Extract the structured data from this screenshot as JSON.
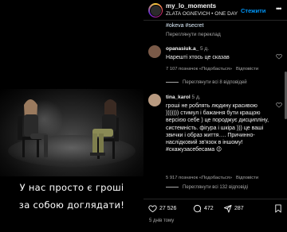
{
  "video": {
    "caption_line1": "У нас просто є гроші",
    "caption_line2": "за собою доглядати!"
  },
  "header": {
    "username": "my_lo_moments",
    "subtitle": "ZLATA OGNEVICH • ONE DAY",
    "follow_label": "Стежити",
    "more_icon": "more-dots-icon"
  },
  "post": {
    "hashtags": "#okeva #secret",
    "translate_label": "Переглянути переклад"
  },
  "comments": [
    {
      "username": "opanasiuk.a_",
      "time": "5 д.",
      "text": "Нарешті хтось це сказав",
      "likes": "7 107 позначок «Подобається»",
      "reply_label": "Відповісти",
      "replies_label": "Переглянути всі 8 відповідей"
    },
    {
      "username": "tina_karol",
      "time": "5 д.",
      "text": "гроші не роблять людину красивою ))))))) стимул і бажання бути кращою версією себе ) це породжує дисципліну, системність. фігура і шкіра ))) це ваші звички і образ життя…. Причинно-наслідковий зв'язок в іншому! #скажузасебесама 😉",
      "likes": "5 917 позначок «Подобається»",
      "reply_label": "Відповісти",
      "replies_label": "Переглянути всі 132 відповіді"
    }
  ],
  "actions": {
    "likes_count": "27 526",
    "comments_count": "472",
    "shares_count": "287"
  },
  "date": "5 днів тому",
  "colors": {
    "link_blue": "#0095f6",
    "muted": "#a8a8a8",
    "background": "#000000"
  }
}
